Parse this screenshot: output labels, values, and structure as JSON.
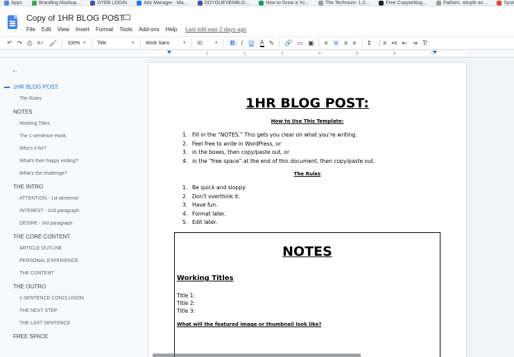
{
  "bookmarks": [
    {
      "label": "Apps",
      "color": "#4285f4"
    },
    {
      "label": "Branding Mockup...",
      "color": "#34a853"
    },
    {
      "label": "DYEB LOGIN",
      "color": "#3f51b5"
    },
    {
      "label": "Ads Manager - Ma...",
      "color": "#1877f2"
    },
    {
      "label": "DOYOUEVENBLO...",
      "color": "#3f51b5"
    },
    {
      "label": "How to Grow a Yo...",
      "color": "#0f9d58"
    },
    {
      "label": "The Technium: 1,0...",
      "color": "#9e9e9e"
    },
    {
      "label": "Free Copywriting...",
      "color": "#202124"
    },
    {
      "label": "Fathom, simple an...",
      "color": "#9e9e9e"
    },
    {
      "label": "Syste",
      "color": "#ea4335"
    }
  ],
  "header": {
    "title": "Copy of 1HR BLOG POST",
    "menus": [
      "File",
      "Edit",
      "View",
      "Insert",
      "Format",
      "Tools",
      "Add-ons",
      "Help"
    ],
    "last_edit": "Last edit was 2 days ago"
  },
  "toolbar": {
    "zoom": "100%",
    "style": "Title",
    "font": "Work Sans",
    "size": "31",
    "bold": "B",
    "italic": "I",
    "underline": "U",
    "text_color": "A"
  },
  "ruler": {
    "marks": [
      "1",
      "2",
      "3",
      "4",
      "5",
      "6",
      "7"
    ]
  },
  "outline": {
    "items": [
      {
        "label": "1HR BLOG POST:",
        "level": 1,
        "active": true
      },
      {
        "label": "The Rules",
        "level": 2
      },
      {
        "label": "NOTES",
        "level": 1
      },
      {
        "label": "Working Titles",
        "level": 2
      },
      {
        "label": "The 1-sentence Hook",
        "level": 2
      },
      {
        "label": "Who's it for?",
        "level": 2
      },
      {
        "label": "What's their happy ending?",
        "level": 2
      },
      {
        "label": "What's the challenge?",
        "level": 2
      },
      {
        "label": "THE INTRO",
        "level": 1
      },
      {
        "label": "ATTENTION - 1st sentence",
        "level": 2
      },
      {
        "label": "INTEREST - 2nd paragraph",
        "level": 2
      },
      {
        "label": "DESIRE - 3rd paragraph",
        "level": 2
      },
      {
        "label": "THE CORE CONTENT",
        "level": 1
      },
      {
        "label": "ARTICLE OUTLINE",
        "level": 2
      },
      {
        "label": "PERSONAL EXPERIENCE",
        "level": 2
      },
      {
        "label": "THE CONTENT",
        "level": 2
      },
      {
        "label": "THE OUTRO",
        "level": 1
      },
      {
        "label": "1-SENTENCE CONCLUSION",
        "level": 2
      },
      {
        "label": "THE NEXT STEP",
        "level": 2
      },
      {
        "label": "THE LAST SENTENCE",
        "level": 2
      },
      {
        "label": "FREE SPACE",
        "level": 1
      }
    ]
  },
  "document": {
    "title": "1HR BLOG POST:",
    "howto_heading": "How to Use This Template:",
    "steps": [
      {
        "num": "1.",
        "text": "Fill in the “NOTES.” This gets you clear on what you’re writing."
      },
      {
        "num": "2.",
        "pre": "Feel free to ",
        "em": "write",
        "post": " in WordPress, or"
      },
      {
        "num": "3.",
        "text": "in the boxes, then copy/paste out, or"
      },
      {
        "num": "4.",
        "text": "in the “free space” at the end of this document, then copy/paste out."
      }
    ],
    "rules_heading": "The Rules",
    "rules": [
      {
        "num": "1.",
        "text": "Be quick and sloppy."
      },
      {
        "num": "2.",
        "text": "Don’t overthink it."
      },
      {
        "num": "3.",
        "text": "Have fun."
      },
      {
        "num": "4.",
        "text": "Format later."
      },
      {
        "num": "5.",
        "text": "Edit later."
      }
    ],
    "notes": {
      "title": "NOTES",
      "working_titles_heading": "Working Titles",
      "title_lines": [
        "Title 1:",
        "Title 2:",
        "Title 3:"
      ],
      "featured_question": "What will the featured image or thumbnail look like?"
    }
  }
}
